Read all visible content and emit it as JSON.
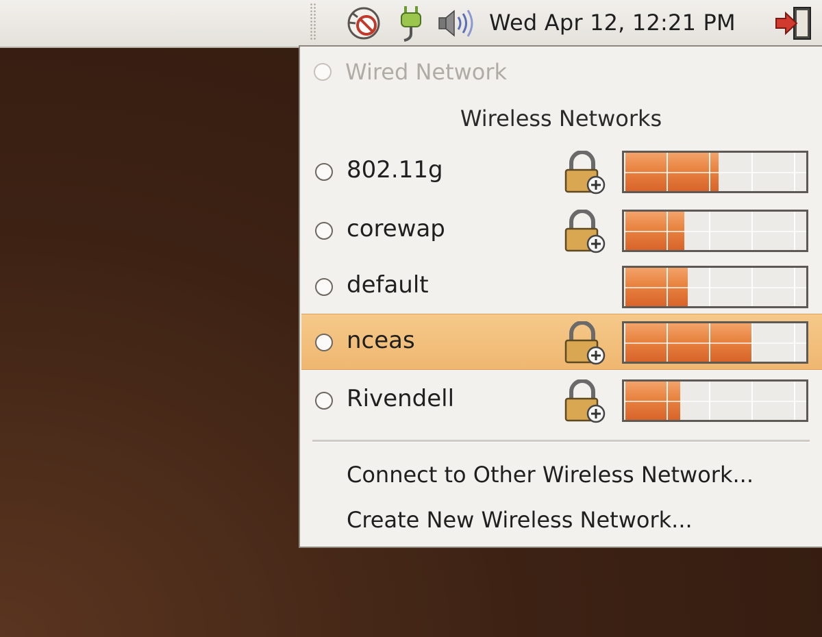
{
  "panel": {
    "clock": "Wed Apr 12, 12:21 PM",
    "tray_icons": [
      "update-notifier-icon",
      "network-manager-icon",
      "volume-icon",
      "logout-icon"
    ]
  },
  "menu": {
    "wired": {
      "label": "Wired Network",
      "enabled": false
    },
    "wireless_title": "Wireless Networks",
    "networks": [
      {
        "name": "802.11g",
        "secured": true,
        "signal": 0.52,
        "selected": false
      },
      {
        "name": "corewap",
        "secured": true,
        "signal": 0.33,
        "selected": false
      },
      {
        "name": "default",
        "secured": false,
        "signal": 0.35,
        "selected": false
      },
      {
        "name": "nceas",
        "secured": true,
        "signal": 0.7,
        "selected": true
      },
      {
        "name": "Rivendell",
        "secured": true,
        "signal": 0.31,
        "selected": false
      }
    ],
    "actions": {
      "connect_other": "Connect to Other Wireless Network...",
      "create_new": "Create New Wireless Network..."
    }
  },
  "colors": {
    "signal_fill": "#e88340",
    "selected_row": "#f2c07d",
    "desktop": "#3d2214"
  }
}
